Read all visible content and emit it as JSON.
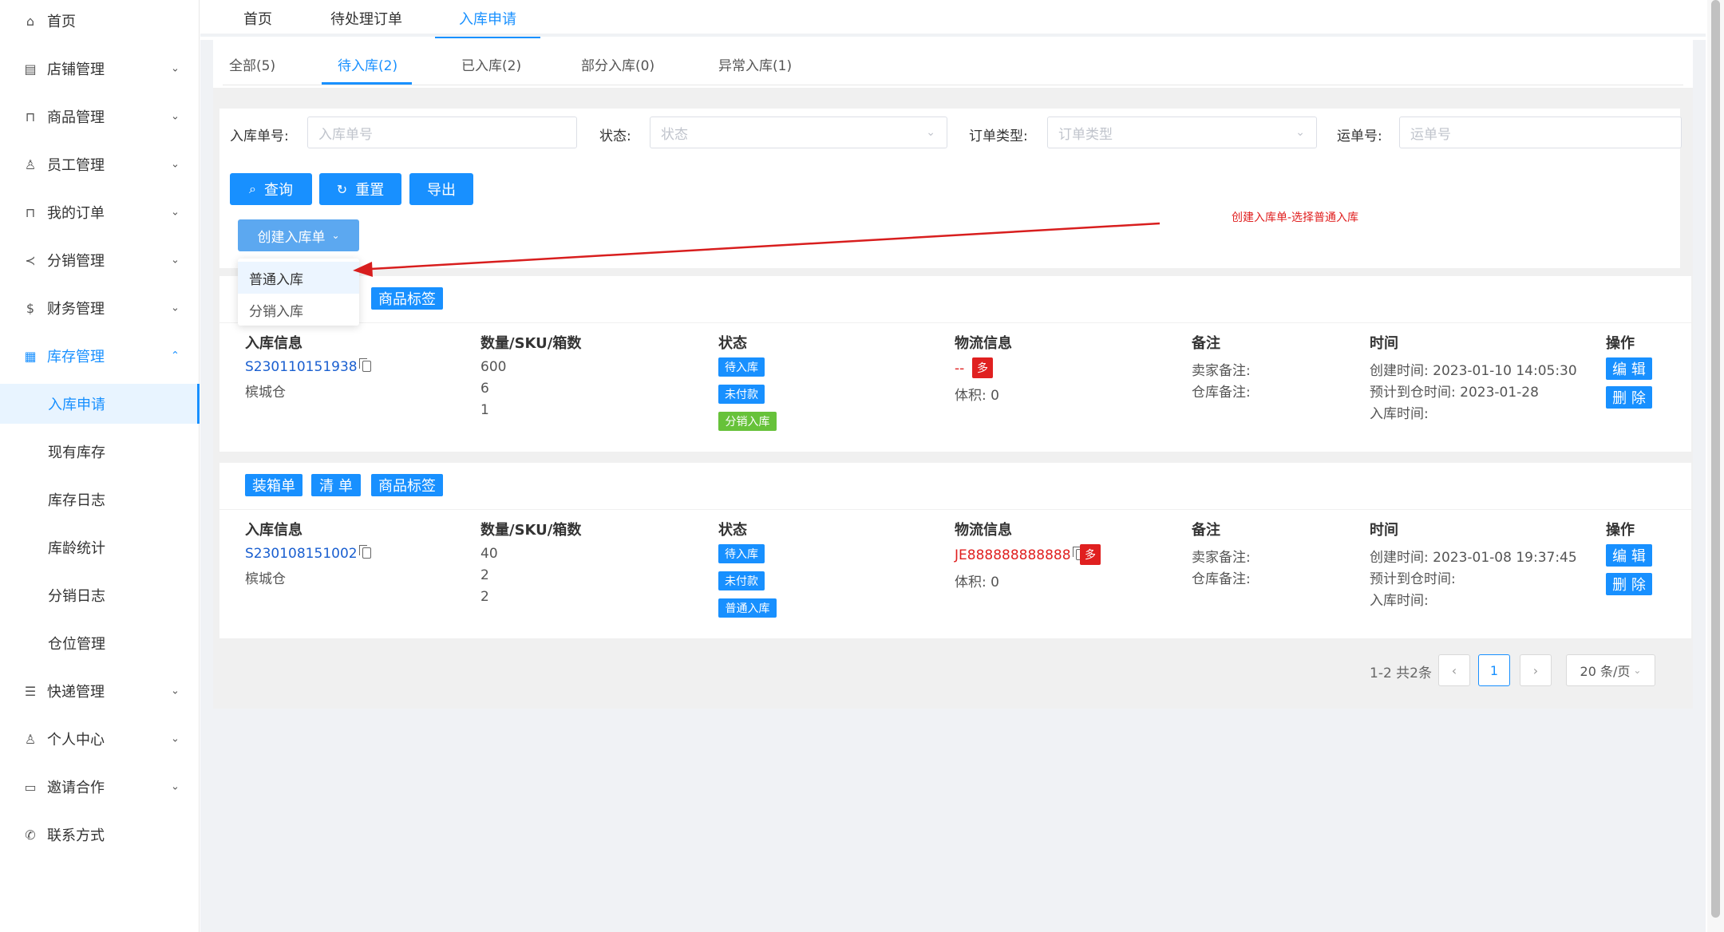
{
  "sidebar": {
    "items": [
      {
        "label": "首页",
        "icon": "home-icon",
        "expandable": false
      },
      {
        "label": "店铺管理",
        "icon": "store-icon",
        "expandable": true
      },
      {
        "label": "商品管理",
        "icon": "bag-icon",
        "expandable": true
      },
      {
        "label": "员工管理",
        "icon": "users-icon",
        "expandable": true
      },
      {
        "label": "我的订单",
        "icon": "bag-icon",
        "expandable": true
      },
      {
        "label": "分销管理",
        "icon": "share-icon",
        "expandable": true
      },
      {
        "label": "财务管理",
        "icon": "dollar-icon",
        "expandable": true
      },
      {
        "label": "库存管理",
        "icon": "grid-icon",
        "expandable": true,
        "open": true
      },
      {
        "label": "入库申请",
        "sub": true,
        "active": true
      },
      {
        "label": "现有库存",
        "sub": true
      },
      {
        "label": "库存日志",
        "sub": true
      },
      {
        "label": "库龄统计",
        "sub": true
      },
      {
        "label": "分销日志",
        "sub": true
      },
      {
        "label": "仓位管理",
        "sub": true
      },
      {
        "label": "快递管理",
        "icon": "list-icon",
        "expandable": true
      },
      {
        "label": "个人中心",
        "icon": "user-icon",
        "expandable": true
      },
      {
        "label": "邀请合作",
        "icon": "laptop-icon",
        "expandable": true
      },
      {
        "label": "联系方式",
        "icon": "phone-icon",
        "expandable": false
      }
    ]
  },
  "top_tabs": [
    "首页",
    "待处理订单",
    "入库申请"
  ],
  "sub_tabs": [
    "全部(5)",
    "待入库(2)",
    "已入库(2)",
    "部分入库(0)",
    "异常入库(1)"
  ],
  "filters": {
    "inbound_no": {
      "label": "入库单号:",
      "placeholder": "入库单号"
    },
    "status": {
      "label": "状态:",
      "placeholder": "状态"
    },
    "order_type": {
      "label": "订单类型:",
      "placeholder": "订单类型"
    },
    "waybill": {
      "label": "运单号:",
      "placeholder": "运单号"
    }
  },
  "buttons": {
    "query": "查询",
    "reset": "重置",
    "export": "导出",
    "create": "创建入库单"
  },
  "create_menu": [
    "普通入库",
    "分销入库"
  ],
  "annotation": "创建入库单-选择普通入库",
  "table_headers": [
    "入库信息",
    "数量/SKU/箱数",
    "状态",
    "物流信息",
    "备注",
    "时间",
    "操作"
  ],
  "records": [
    {
      "actions": [
        "商品标签"
      ],
      "order_no": "S230110151938",
      "warehouse": "槟城仓",
      "qty": "600",
      "sku": "6",
      "boxes": "1",
      "statuses": [
        {
          "text": "待入库",
          "color": "#1890ff"
        },
        {
          "text": "未付款",
          "color": "#1890ff"
        },
        {
          "text": "分销入库",
          "color": "#67c23a"
        }
      ],
      "logistics": "--",
      "multi_badge": "多",
      "volume": "体积:  0",
      "seller_note": "卖家备注:",
      "warehouse_note": "仓库备注:",
      "created": "创建时间:  2023-01-10 14:05:30",
      "eta": "预计到仓时间:  2023-01-28",
      "inbound_time": "入库时间:",
      "op_edit": "编 辑",
      "op_delete": "删 除"
    },
    {
      "actions": [
        "装箱单",
        "清 单",
        "商品标签"
      ],
      "order_no": "S230108151002",
      "warehouse": "槟城仓",
      "qty": "40",
      "sku": "2",
      "boxes": "2",
      "statuses": [
        {
          "text": "待入库",
          "color": "#1890ff"
        },
        {
          "text": "未付款",
          "color": "#1890ff"
        },
        {
          "text": "普通入库",
          "color": "#1890ff"
        }
      ],
      "logistics": "JE888888888888",
      "multi_badge": "多",
      "volume": "体积:  0",
      "seller_note": "卖家备注:",
      "warehouse_note": "仓库备注:",
      "created": "创建时间:  2023-01-08 19:37:45",
      "eta": "预计到仓时间:",
      "inbound_time": "入库时间:",
      "op_edit": "编 辑",
      "op_delete": "删 除"
    }
  ],
  "pagination": {
    "summary": "1-2 共2条",
    "current": "1",
    "page_size": "20 条/页"
  },
  "colors": {
    "primary": "#1890ff",
    "danger": "#e02020",
    "success": "#67c23a"
  }
}
